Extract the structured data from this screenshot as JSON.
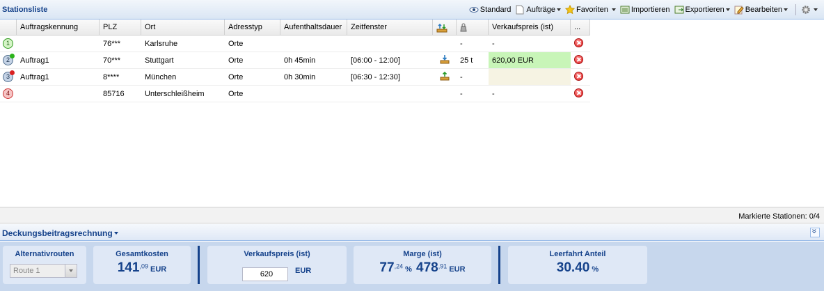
{
  "panel": {
    "title": "Stationsliste"
  },
  "toolbar": {
    "standard": "Standard",
    "auftraege": "Aufträge",
    "favoriten": "Favoriten",
    "importieren": "Importieren",
    "exportieren": "Exportieren",
    "bearbeiten": "Bearbeiten"
  },
  "grid": {
    "headers": [
      "Auftragskennung",
      "PLZ",
      "Ort",
      "Adresstyp",
      "Aufenthaltsdauer",
      "Zeitfenster",
      "",
      "",
      "Verkaufspreis (ist)",
      "..."
    ],
    "rows": [
      {
        "num": "1",
        "auftrag": "",
        "plz": "76***",
        "ort": "Karlsruhe",
        "typ": "Orte",
        "dauer": "",
        "fenster": "",
        "gewicht": "-",
        "preis": "-",
        "badge": "start",
        "dot": ""
      },
      {
        "num": "2",
        "auftrag": "Auftrag1",
        "plz": "70***",
        "ort": "Stuttgart",
        "typ": "Orte",
        "dauer": "0h 45min",
        "fenster": "[06:00 - 12:00]",
        "gewicht": "25 t",
        "preis": "620,00 EUR",
        "badge": "mid",
        "dot": "#2bb31a",
        "action": "unload"
      },
      {
        "num": "3",
        "auftrag": "Auftrag1",
        "plz": "8****",
        "ort": "München",
        "typ": "Orte",
        "dauer": "0h 30min",
        "fenster": "[06:30 - 12:30]",
        "gewicht": "-",
        "preis": "",
        "badge": "mid",
        "dot": "#d92020",
        "action": "load"
      },
      {
        "num": "4",
        "auftrag": "",
        "plz": "85716",
        "ort": "Unterschleißheim",
        "typ": "Orte",
        "dauer": "",
        "fenster": "",
        "gewicht": "-",
        "preis": "-",
        "badge": "end",
        "dot": ""
      }
    ]
  },
  "status": {
    "markierte": "Markierte Stationen: 0/4"
  },
  "db": {
    "title": "Deckungsbeitragsrechnung",
    "alternativrouten": {
      "label": "Alternativrouten",
      "value": "Route 1"
    },
    "gesamtkosten": {
      "label": "Gesamtkosten",
      "int": "141",
      "dec": ",09",
      "unit": "EUR"
    },
    "verkaufspreis": {
      "label": "Verkaufspreis (ist)",
      "value": "620",
      "unit": "EUR"
    },
    "marge": {
      "label": "Marge (ist)",
      "pct_int": "77",
      "pct_dec": ",24",
      "pct_unit": "%",
      "abs_int": "478",
      "abs_dec": ",91",
      "abs_unit": "EUR"
    },
    "leerfahrt": {
      "label": "Leerfahrt Anteil",
      "value": "30.40",
      "unit": "%"
    }
  }
}
